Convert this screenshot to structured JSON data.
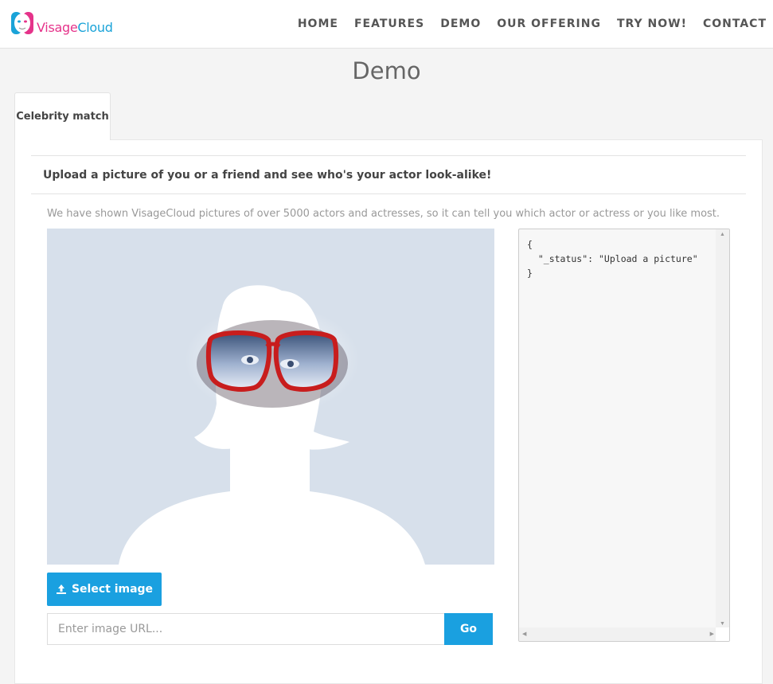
{
  "header": {
    "logo_text_a": "Visage",
    "logo_text_b": "Cloud",
    "nav": [
      "HOME",
      "FEATURES",
      "DEMO",
      "OUR OFFERING",
      "TRY NOW!",
      "CONTACT"
    ]
  },
  "page_title": "Demo",
  "tab_label": "Celebrity match",
  "card_heading": "Upload a picture of you or a friend and see who's your actor look-alike!",
  "description": "We have shown VisageCloud pictures of over 5000 actors and actresses, so it can tell you which actor or actress or you like most.",
  "select_button_label": "Select image",
  "url_placeholder": "Enter image URL...",
  "go_label": "Go",
  "json_output": "{\n  \"_status\": \"Upload a picture\"\n}",
  "icons": {
    "upload": "upload-icon",
    "logo": "face-logo-icon"
  },
  "colors": {
    "accent": "#1aa0e0",
    "logo_pink": "#e5338a",
    "logo_blue": "#1aa3d8",
    "placeholder_bg": "#d7e0eb",
    "glasses_red": "#d11f1f"
  }
}
